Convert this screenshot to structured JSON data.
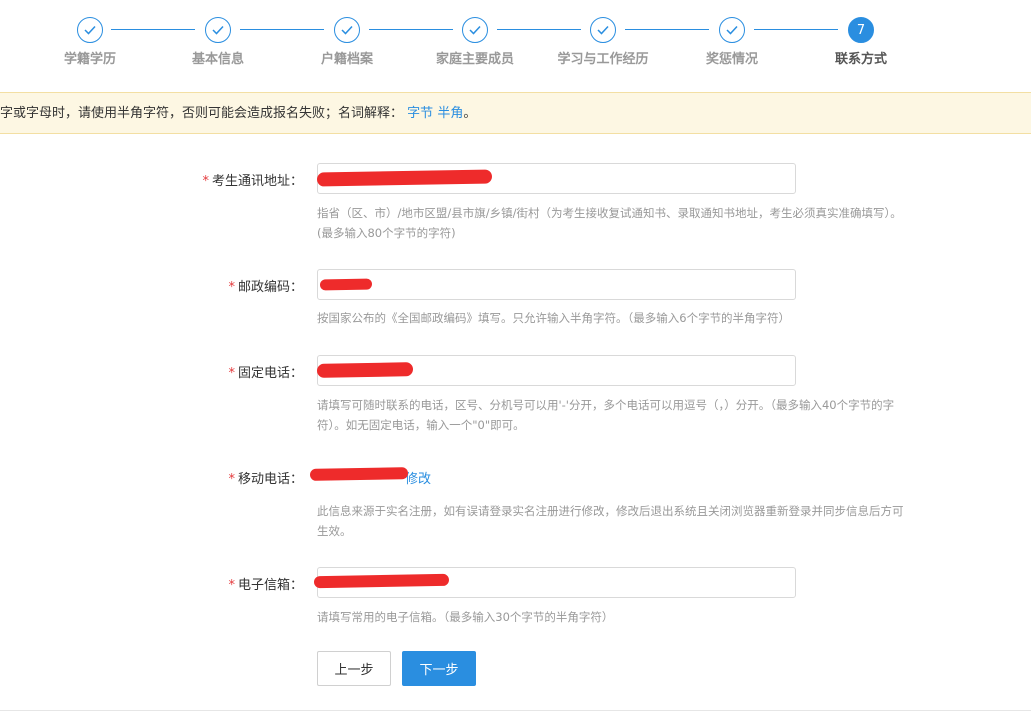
{
  "steps": [
    {
      "label": "学籍学历",
      "done": true
    },
    {
      "label": "基本信息",
      "done": true
    },
    {
      "label": "户籍档案",
      "done": true
    },
    {
      "label": "家庭主要成员",
      "done": true
    },
    {
      "label": "学习与工作经历",
      "done": true
    },
    {
      "label": "奖惩情况",
      "done": true
    },
    {
      "label": "联系方式",
      "done": false,
      "number": "7"
    }
  ],
  "notice": {
    "text": "字或字母时，请使用半角字符，否则可能会造成报名失败；名词解释：",
    "link_byte": "字节",
    "link_half": "半角",
    "end": "。"
  },
  "form": {
    "required_mark": "*",
    "address": {
      "label": "考生通讯地址：",
      "value": "",
      "hint_line1": "指省（区、市）/地市区盟/县市旗/乡镇/街村（为考生接收复试通知书、录取通知书地址，考生必须真实准确填写）。",
      "hint_line2": "(最多输入80个字节的字符)"
    },
    "postcode": {
      "label": "邮政编码：",
      "value": "",
      "hint": "按国家公布的《全国邮政编码》填写。只允许输入半角字符。（最多输入6个字节的半角字符）"
    },
    "phone": {
      "label": "固定电话：",
      "value": "",
      "hint_line1": "请填写可随时联系的电话，区号、分机号可以用'-'分开，多个电话可以用逗号（，）分开。（最多输入40个字节的字",
      "hint_line2": "符）。如无固定电话，输入一个\"0\"即可。"
    },
    "mobile": {
      "label": "移动电话：",
      "value": "",
      "edit_link": "修改",
      "hint_line1": "此信息来源于实名注册，如有误请登录实名注册进行修改，修改后退出系统且关闭浏览器重新登录并同步信息后方可",
      "hint_line2": "生效。"
    },
    "email": {
      "label": "电子信箱：",
      "value": "",
      "hint": "请填写常用的电子信箱。（最多输入30个字节的半角字符）"
    }
  },
  "buttons": {
    "prev": "上一步",
    "next": "下一步"
  },
  "colors": {
    "primary": "#2a8ee0",
    "required": "#e4393c",
    "notice_bg": "#fdf7e3",
    "redaction": "#ee2b2b"
  }
}
